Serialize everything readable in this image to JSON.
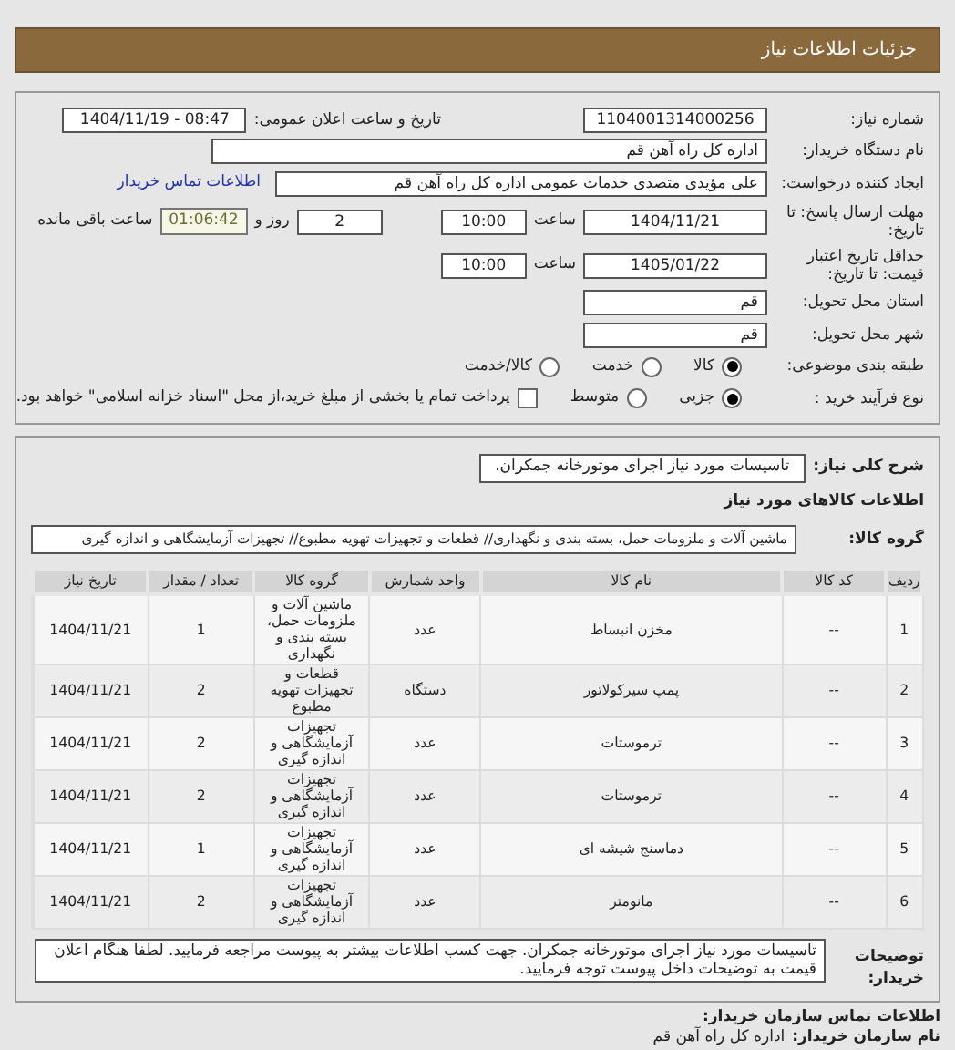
{
  "header": {
    "title": "جزئیات اطلاعات نیاز"
  },
  "need_number": {
    "label": "شماره نیاز:",
    "value": "1104001314000256"
  },
  "announce": {
    "label": "تاریخ و ساعت اعلان عمومی:",
    "value": "1404/11/19 - 08:47"
  },
  "buyer_org": {
    "label": "نام دستگاه خریدار:",
    "value": "اداره کل  راه آهن قم"
  },
  "requester": {
    "label": "ایجاد کننده درخواست:",
    "value": "علی مؤیدی متصدی خدمات عمومی اداره کل  راه آهن قم",
    "link": "اطلاعات تماس خریدار"
  },
  "response_deadline": {
    "label": "مهلت ارسال پاسخ: تا تاریخ:",
    "date": "1404/11/21",
    "time_label": "ساعت",
    "time": "10:00",
    "days": "2",
    "days_label": "روز و",
    "remaining": "01:06:42",
    "remaining_label": "ساعت باقی مانده"
  },
  "price_validity": {
    "label": "حداقل تاریخ اعتبار قیمت: تا تاریخ:",
    "date": "1405/01/22",
    "time_label": "ساعت",
    "time": "10:00"
  },
  "delivery_province": {
    "label": "استان محل تحویل:",
    "value": "قم"
  },
  "delivery_city": {
    "label": "شهر محل تحویل:",
    "value": "قم"
  },
  "category": {
    "label": "طبقه بندی موضوعی:",
    "options": [
      {
        "kind": "radio",
        "label": "کالا",
        "selected": true
      },
      {
        "kind": "radio",
        "label": "خدمت",
        "selected": false
      },
      {
        "kind": "radio",
        "label": "کالا/خدمت",
        "selected": false
      }
    ]
  },
  "process": {
    "label": "نوع فرآیند خرید :",
    "options": [
      {
        "kind": "radio",
        "label": "جزیی",
        "selected": true
      },
      {
        "kind": "radio",
        "label": "متوسط",
        "selected": false
      },
      {
        "kind": "checkbox",
        "label": "پرداخت تمام یا بخشی از مبلغ خرید،از محل \"اسناد خزانه اسلامی\" خواهد بود.",
        "selected": false
      }
    ]
  },
  "summary": {
    "label": "شرح کلی نیاز:",
    "value": "تاسیسات مورد نیاز اجرای موتورخانه جمکران."
  },
  "goods_heading": "اطلاعات کالاهای مورد نیاز",
  "goods_group": {
    "label": "گروه کالا:",
    "value": "ماشین آلات و ملزومات حمل، بسته بندی و نگهداری// قطعات و تجهیزات تهویه مطبوع// تجهیزات آزمایشگاهی و اندازه گیری"
  },
  "table": {
    "columns": [
      "ردیف",
      "کد کالا",
      "نام کالا",
      "واحد شمارش",
      "گروه کالا",
      "تعداد / مقدار",
      "تاریخ نیاز"
    ],
    "rows": [
      [
        "1",
        "--",
        "مخزن انبساط",
        "عدد",
        "ماشین آلات و ملزومات حمل، بسته بندی و نگهداری",
        "1",
        "1404/11/21"
      ],
      [
        "2",
        "--",
        "پمپ سیرکولاتور",
        "دستگاه",
        "قطعات و تجهیزات تهویه مطبوع",
        "2",
        "1404/11/21"
      ],
      [
        "3",
        "--",
        "ترموستات",
        "عدد",
        "تجهیزات آزمایشگاهی و اندازه گیری",
        "2",
        "1404/11/21"
      ],
      [
        "4",
        "--",
        "ترموستات",
        "عدد",
        "تجهیزات آزمایشگاهی و اندازه گیری",
        "2",
        "1404/11/21"
      ],
      [
        "5",
        "--",
        "دماسنج شیشه ای",
        "عدد",
        "تجهیزات آزمایشگاهی و اندازه گیری",
        "1",
        "1404/11/21"
      ],
      [
        "6",
        "--",
        "مانومتر",
        "عدد",
        "تجهیزات آزمایشگاهی و اندازه گیری",
        "2",
        "1404/11/21"
      ]
    ]
  },
  "buyer_notes": {
    "label": "توضیحات خریدار:",
    "value": "تاسیسات مورد نیاز اجرای موتورخانه جمکران. جهت کسب اطلاعات بیشتر به پیوست مراجعه فرمایید. لطفا هنگام اعلان قیمت به توضیحات داخل پیوست توجه فرمایید."
  },
  "contact": {
    "heading": "اطلاعات تماس سازمان خریدار:",
    "org_label": "نام سازمان خریدار:",
    "org_value": "اداره کل راه آهن قم"
  }
}
